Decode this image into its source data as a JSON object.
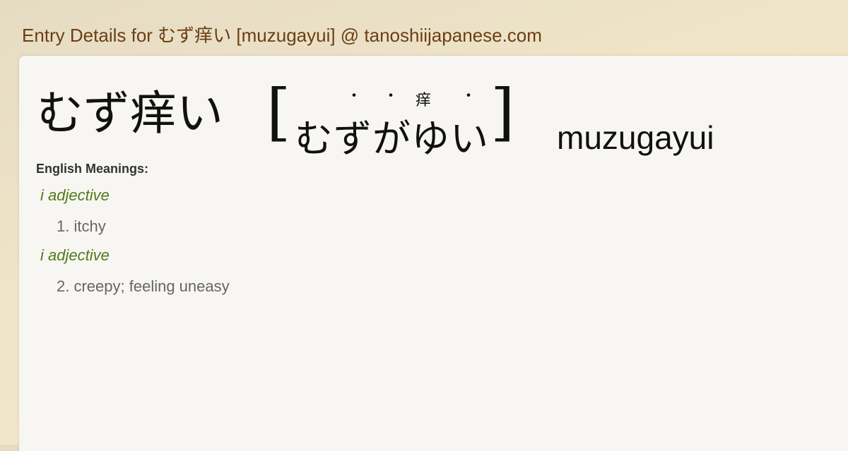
{
  "header": {
    "title": "Entry Details for むず痒い [muzugayui] @ tanoshiijapanese.com"
  },
  "entry": {
    "headword": "むず痒い",
    "bracket_open": "[",
    "bracket_close": "]",
    "reading": [
      "む",
      "ず",
      "が",
      "ゆ",
      "い"
    ],
    "furigana": {
      "dot": "・",
      "kanji": "痒"
    },
    "romaji": "muzugayui"
  },
  "meanings": {
    "label": "English Meanings:",
    "senses": [
      {
        "pos": "i adjective",
        "number": "1.",
        "text": "itchy"
      },
      {
        "pos": "i adjective",
        "number": "2.",
        "text": "creepy; feeling uneasy"
      }
    ]
  },
  "colors": {
    "header_text": "#6b3e12",
    "pos_text": "#4f7a18",
    "gloss_text": "#666666",
    "card_background": "#f7f6f2"
  }
}
